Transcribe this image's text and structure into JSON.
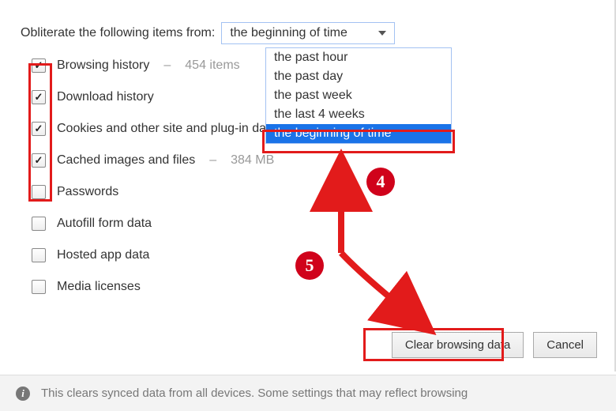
{
  "prompt": "Obliterate the following items from:",
  "timerange": {
    "selected": "the beginning of time",
    "options": [
      "the past hour",
      "the past day",
      "the past week",
      "the last 4 weeks",
      "the beginning of time"
    ]
  },
  "items": [
    {
      "label": "Browsing history",
      "meta": "454 items",
      "checked": true
    },
    {
      "label": "Download history",
      "meta": "",
      "checked": true
    },
    {
      "label": "Cookies and other site and plug-in data",
      "meta": "",
      "checked": true
    },
    {
      "label": "Cached images and files",
      "meta": "384 MB",
      "checked": true
    },
    {
      "label": "Passwords",
      "meta": "",
      "checked": false
    },
    {
      "label": "Autofill form data",
      "meta": "",
      "checked": false
    },
    {
      "label": "Hosted app data",
      "meta": "",
      "checked": false
    },
    {
      "label": "Media licenses",
      "meta": "",
      "checked": false
    }
  ],
  "buttons": {
    "clear": "Clear browsing data",
    "cancel": "Cancel"
  },
  "footer": "This clears synced data from all devices. Some settings that may reflect browsing",
  "annotations": {
    "badge4": "4",
    "badge5": "5"
  }
}
